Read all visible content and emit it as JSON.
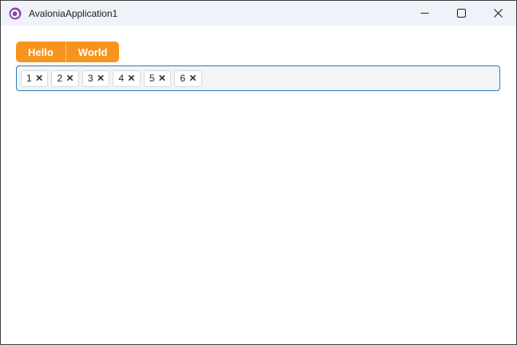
{
  "window": {
    "title": "AvaloniaApplication1",
    "icon": "avalonia-logo-icon",
    "controls": [
      {
        "name": "minimize",
        "icon": "minimize-icon"
      },
      {
        "name": "maximize",
        "icon": "maximize-icon"
      },
      {
        "name": "close",
        "icon": "close-icon"
      }
    ]
  },
  "tabstrip": {
    "tabs": [
      {
        "label": "Hello"
      },
      {
        "label": "World"
      }
    ]
  },
  "chips": {
    "items": [
      {
        "value": "1",
        "remove_glyph": "×"
      },
      {
        "value": "2",
        "remove_glyph": "×"
      },
      {
        "value": "3",
        "remove_glyph": "×"
      },
      {
        "value": "4",
        "remove_glyph": "×"
      },
      {
        "value": "5",
        "remove_glyph": "×"
      },
      {
        "value": "6",
        "remove_glyph": "×"
      }
    ]
  },
  "colors": {
    "accent_orange": "#F7941D",
    "tab_divider": "rgba(255,255,255,0.45)",
    "focus_border_blue": "#2B7CB2",
    "titlebar_bg": "#EFF3F9",
    "window_border": "#3F3F3F",
    "field_bg": "#F4F4F5",
    "chip_bg": "#FFFFFF",
    "chip_border": "#D8D8D8",
    "logo_purple": "#8B44A8"
  }
}
